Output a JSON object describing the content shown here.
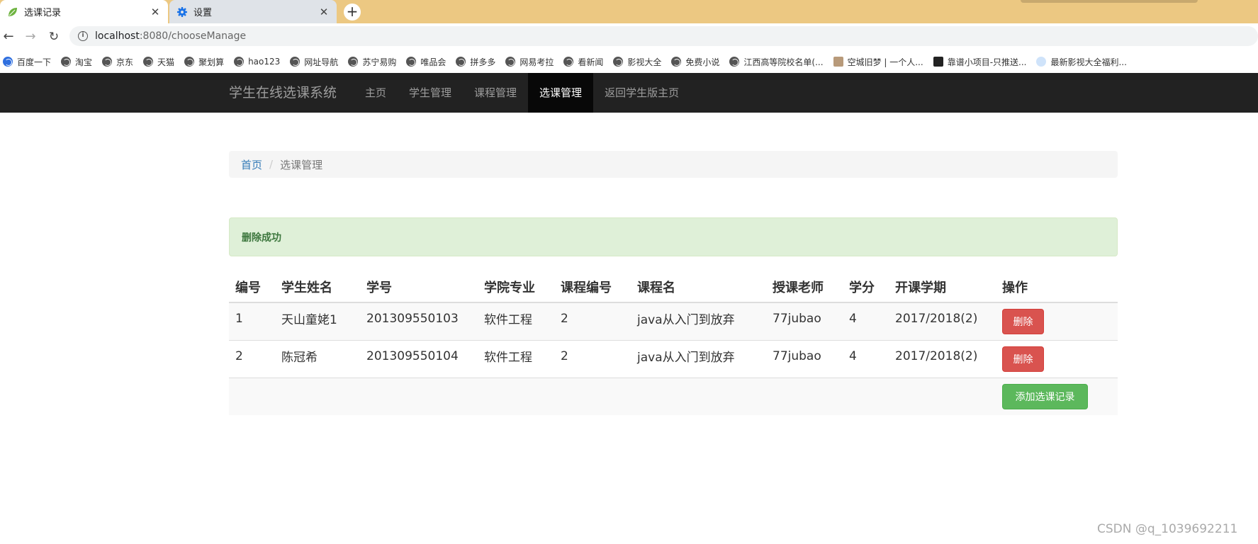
{
  "browser": {
    "tabs": [
      {
        "title": "选课记录",
        "icon": "leaf-icon",
        "active": true
      },
      {
        "title": "设置",
        "icon": "gear-icon",
        "active": false
      }
    ],
    "new_tab": "+",
    "address": {
      "host": "localhost",
      "path": ":8080/chooseManage"
    },
    "bookmarks": [
      {
        "label": "百度一下",
        "icon": "baidu-paw-icon"
      },
      {
        "label": "淘宝",
        "icon": "globe-icon"
      },
      {
        "label": "京东",
        "icon": "globe-icon"
      },
      {
        "label": "天猫",
        "icon": "globe-icon"
      },
      {
        "label": "聚划算",
        "icon": "globe-icon"
      },
      {
        "label": "hao123",
        "icon": "globe-icon"
      },
      {
        "label": "网址导航",
        "icon": "globe-icon"
      },
      {
        "label": "苏宁易购",
        "icon": "globe-icon"
      },
      {
        "label": "唯品会",
        "icon": "globe-icon"
      },
      {
        "label": "拼多多",
        "icon": "globe-icon"
      },
      {
        "label": "网易考拉",
        "icon": "globe-icon"
      },
      {
        "label": "看新闻",
        "icon": "globe-icon"
      },
      {
        "label": "影视大全",
        "icon": "globe-icon"
      },
      {
        "label": "免费小说",
        "icon": "globe-icon"
      },
      {
        "label": "江西高等院校名单(...",
        "icon": "globe-icon"
      },
      {
        "label": "空城旧梦 | 一个人...",
        "icon": "image-icon"
      },
      {
        "label": "靠谱小项目-只推送...",
        "icon": "x-icon"
      },
      {
        "label": "最新影视大全福利...",
        "icon": "shield-icon"
      }
    ]
  },
  "navbar": {
    "brand": "学生在线选课系统",
    "links": [
      "主页",
      "学生管理",
      "课程管理",
      "选课管理",
      "返回学生版主页"
    ],
    "active": "选课管理"
  },
  "breadcrumb": {
    "home": "首页",
    "separator": "/",
    "current": "选课管理"
  },
  "alert": {
    "message": "删除成功"
  },
  "table": {
    "headers": [
      "编号",
      "学生姓名",
      "学号",
      "学院专业",
      "课程编号",
      "课程名",
      "授课老师",
      "学分",
      "开课学期",
      "操作"
    ],
    "rows": [
      {
        "id": "1",
        "name": "天山童姥1",
        "student_no": "201309550103",
        "major": "软件工程",
        "course_no": "2",
        "course_name": "java从入门到放弃",
        "teacher": "77jubao",
        "credit": "4",
        "term": "2017/2018(2)",
        "action": "删除"
      },
      {
        "id": "2",
        "name": "陈冠希",
        "student_no": "201309550104",
        "major": "软件工程",
        "course_no": "2",
        "course_name": "java从入门到放弃",
        "teacher": "77jubao",
        "credit": "4",
        "term": "2017/2018(2)",
        "action": "删除"
      }
    ],
    "add_button": "添加选课记录"
  },
  "watermark": "CSDN @q_1039692211",
  "colors": {
    "navbar_bg": "#222222",
    "active_nav": "#080808",
    "danger": "#d9534f",
    "success": "#5cb85c",
    "alert_bg": "#dff0d8",
    "tabstrip": "#ecc882"
  }
}
